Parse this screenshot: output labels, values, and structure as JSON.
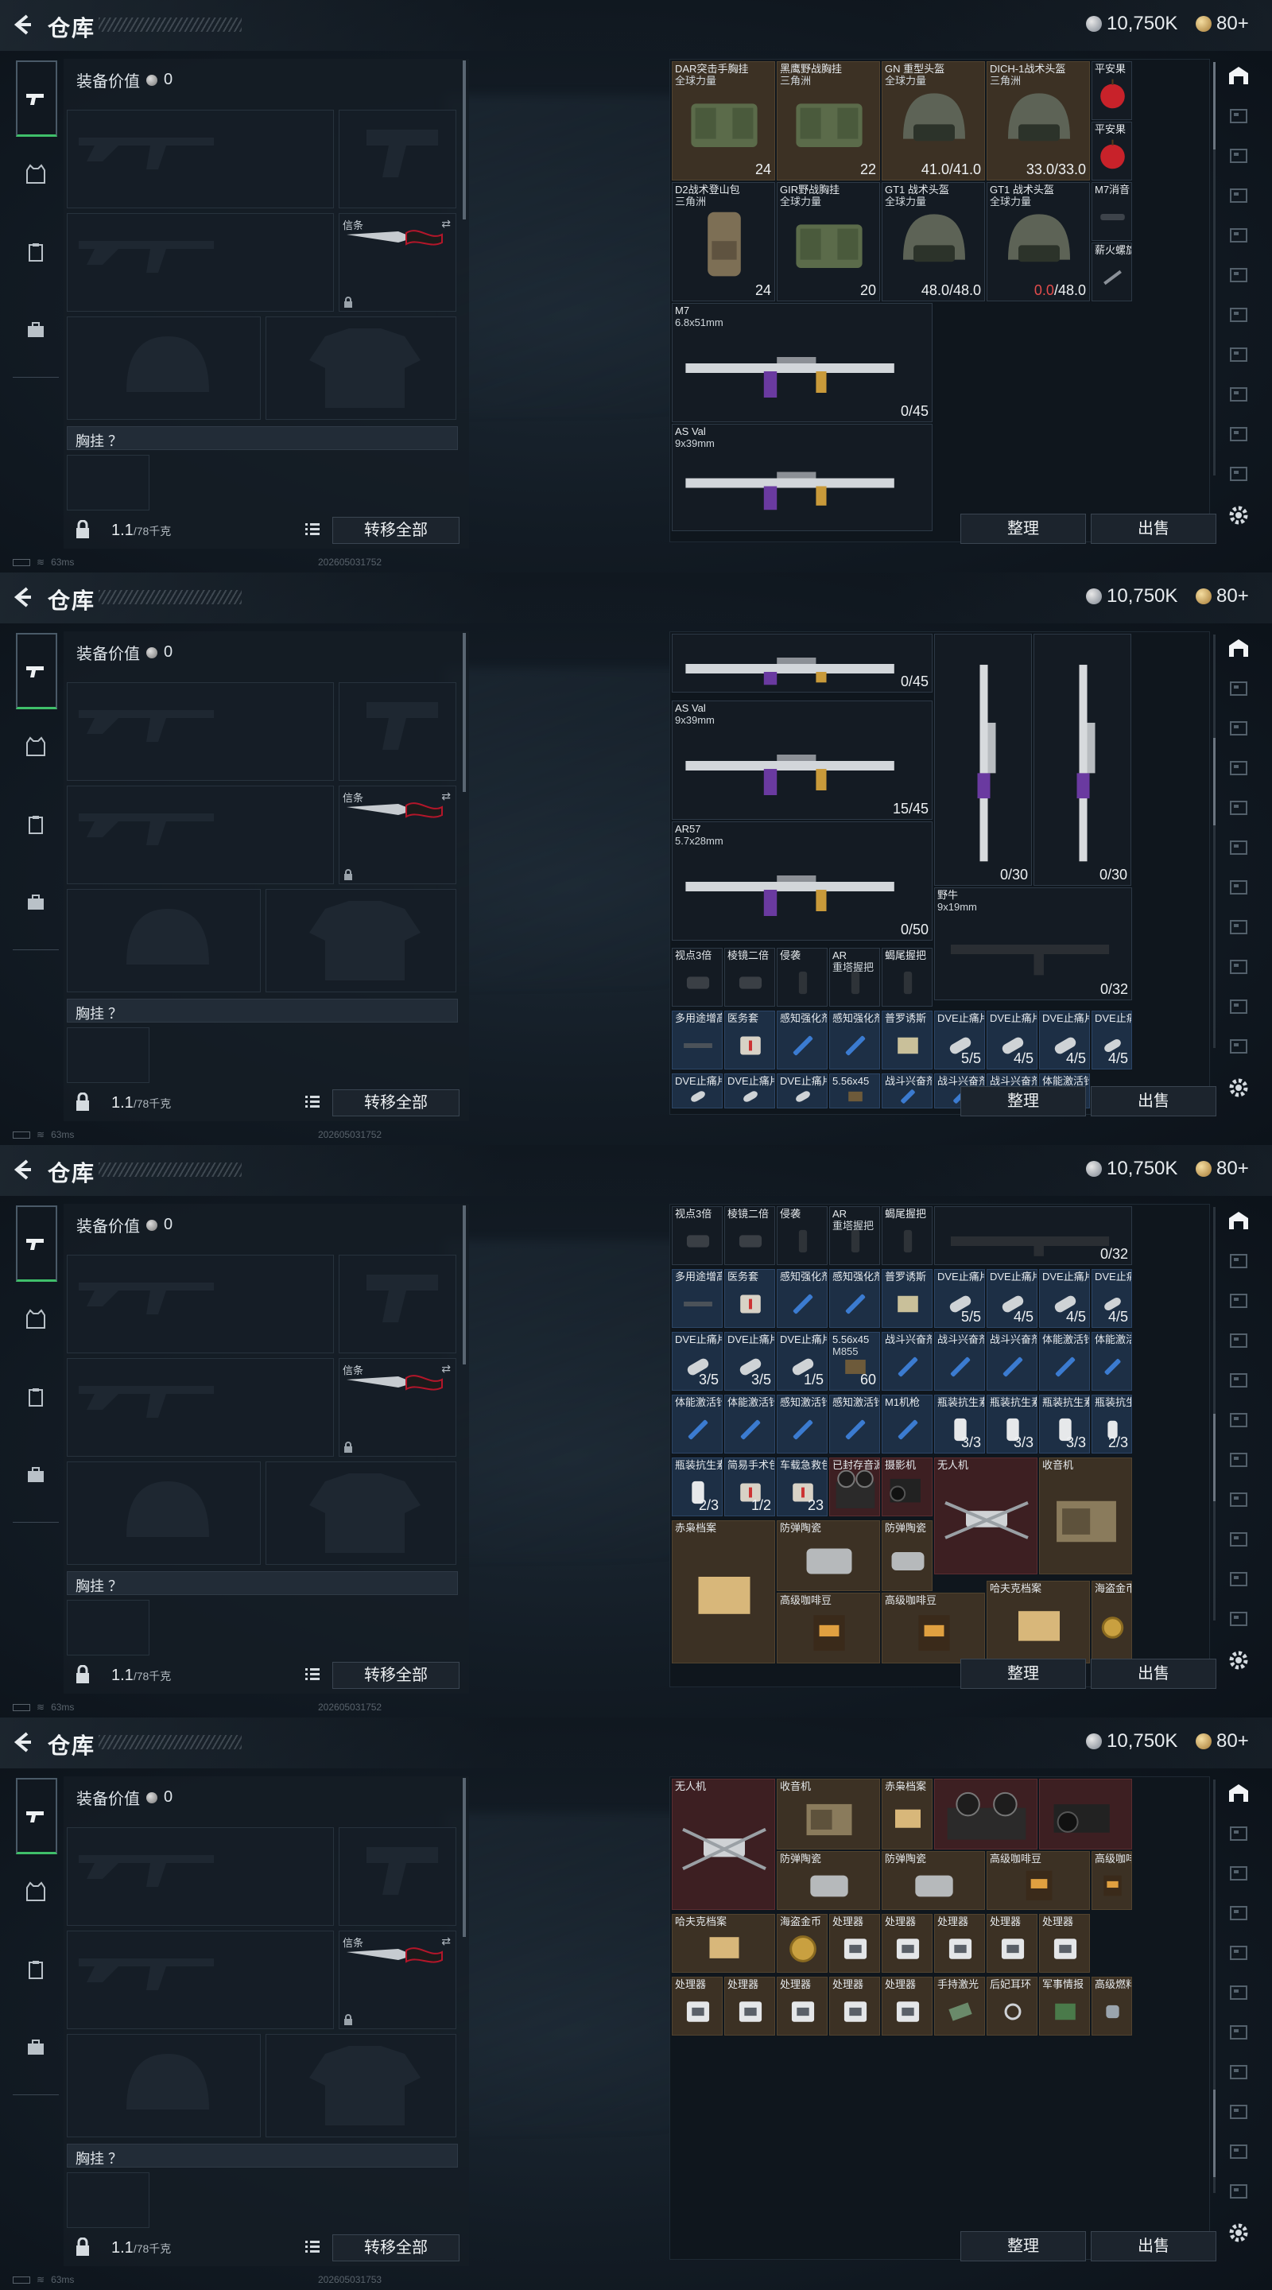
{
  "header": {
    "title": "仓库",
    "currency_coins": "10,750K",
    "currency_gold": "80+"
  },
  "loadout": {
    "equip_value_label": "装备价值",
    "equip_value": "0",
    "melee_label": "信条",
    "chest_label": "胸挂 ？",
    "weight_value": "1.1",
    "weight_cap": "/78千克",
    "transfer_all": "转移全部"
  },
  "status": {
    "latency": "63ms",
    "timestamps": [
      "202605031752",
      "202605031752",
      "202605031752",
      "202605031753"
    ]
  },
  "actions": {
    "sort": "整理",
    "sell": "出售"
  },
  "panels": [
    {
      "cells": [
        {
          "name": "DAR突击手胸挂",
          "sub": "全球力量",
          "qty": "24",
          "icon": "armor-icon",
          "color": "brown"
        },
        {
          "name": "黑鹰野战胸挂",
          "sub": "三角洲",
          "qty": "22",
          "icon": "armor-icon",
          "color": "brown"
        },
        {
          "name": "GN 重型头盔",
          "sub": "全球力量",
          "qty": "41.0/41.0",
          "icon": "helmet-icon",
          "color": "brown"
        },
        {
          "name": "DICH-1战术头盔",
          "sub": "三角洲",
          "qty": "33.0/33.0",
          "icon": "helmet-icon",
          "color": "brown"
        },
        {
          "name": "平安果",
          "sub": "",
          "qty": "",
          "icon": "apple-icon",
          "color": "dark"
        },
        {
          "name": "平安果",
          "sub": "",
          "qty": "",
          "icon": "apple-icon",
          "color": "dark"
        },
        {
          "name": "D2战术登山包",
          "sub": "三角洲",
          "qty": "24",
          "icon": "backpack-icon",
          "color": "dark"
        },
        {
          "name": "GIR野战胸挂",
          "sub": "全球力量",
          "qty": "20",
          "icon": "armor-icon",
          "color": "dark"
        },
        {
          "name": "GT1 战术头盔",
          "sub": "全球力量",
          "qty": "48.0/48.0",
          "icon": "helmet-icon",
          "color": "dark"
        },
        {
          "name": "GT1 战术头盔",
          "sub": "全球力量",
          "qty_red": "0.0",
          "qty": "/48.0",
          "icon": "helmet-icon",
          "color": "dark"
        },
        {
          "name": "M7消音",
          "sub": "",
          "qty": "",
          "icon": "suppressor-icon",
          "color": "dark"
        },
        {
          "name": "薪火螺旋",
          "sub": "",
          "qty": "",
          "icon": "attachment-icon",
          "color": "dark"
        },
        {
          "name": "M7",
          "sub": "6.8x51mm",
          "qty": "0/45",
          "icon": "rifle-icon",
          "color": "dark"
        },
        {
          "name": "M7",
          "sub": "6.8x51mm",
          "qty": "",
          "icon": "rifle-icon",
          "color": "dark"
        },
        {
          "name": "M7",
          "sub": "6.8x51mm",
          "qty": "",
          "icon": "rifle-icon",
          "color": "dark"
        },
        {
          "name": "AS Val",
          "sub": "9x39mm",
          "qty": "",
          "icon": "rifle-icon",
          "color": "dark"
        }
      ]
    },
    {
      "cells": [
        {
          "name": "",
          "sub": "",
          "qty": "0/45",
          "icon": "rifle-icon",
          "color": "dark"
        },
        {
          "name": "AS Val",
          "sub": "9x39mm",
          "qty": "15/45",
          "icon": "rifle-icon",
          "color": "dark"
        },
        {
          "name": "",
          "sub": "",
          "qty": "0/30",
          "icon": "rifle-icon",
          "color": "dark"
        },
        {
          "name": "",
          "sub": "",
          "qty": "0/30",
          "icon": "rifle-icon",
          "color": "dark"
        },
        {
          "name": "AR57",
          "sub": "5.7x28mm",
          "qty": "0/50",
          "icon": "rifle-icon",
          "color": "dark"
        },
        {
          "name": "野牛",
          "sub": "9x19mm",
          "qty": "0/32",
          "icon": "smg-icon",
          "color": "dark"
        },
        {
          "name": "视点3倍",
          "sub": "",
          "qty": "",
          "icon": "scope-icon",
          "color": "dark"
        },
        {
          "name": "棱镜二倍",
          "sub": "",
          "qty": "",
          "icon": "scope-icon",
          "color": "dark"
        },
        {
          "name": "侵袭",
          "sub": "",
          "qty": "",
          "icon": "grip-icon",
          "color": "dark"
        },
        {
          "name": "AR",
          "sub": "重塔握把",
          "qty": "",
          "icon": "grip-icon",
          "color": "dark"
        },
        {
          "name": "蝎尾握把",
          "sub": "",
          "qty": "",
          "icon": "grip-icon",
          "color": "dark"
        },
        {
          "name": "多用途增高",
          "sub": "",
          "qty": "",
          "icon": "rail-icon",
          "color": "blue"
        },
        {
          "name": "医务套",
          "sub": "",
          "qty": "",
          "icon": "medkit-icon",
          "color": "blue"
        },
        {
          "name": "感知强化剂",
          "sub": "",
          "qty": "",
          "icon": "syringe-icon",
          "color": "blue"
        },
        {
          "name": "感知强化剂",
          "sub": "",
          "qty": "",
          "icon": "syringe-icon",
          "color": "blue"
        },
        {
          "name": "普罗诱斯",
          "sub": "",
          "qty": "",
          "icon": "bandage-icon",
          "color": "blue"
        },
        {
          "name": "DVE止痛片",
          "sub": "",
          "qty": "5/5",
          "icon": "pill-icon",
          "color": "blue"
        },
        {
          "name": "DVE止痛片",
          "sub": "",
          "qty": "4/5",
          "icon": "pill-icon",
          "color": "blue"
        },
        {
          "name": "DVE止痛片",
          "sub": "",
          "qty": "4/5",
          "icon": "pill-icon",
          "color": "blue"
        },
        {
          "name": "DVE止痛片",
          "sub": "",
          "qty": "4/5",
          "icon": "pill-icon",
          "color": "blue"
        },
        {
          "name": "DVE止痛片",
          "sub": "",
          "qty": "",
          "icon": "pill-icon",
          "color": "blue"
        },
        {
          "name": "DVE止痛片",
          "sub": "",
          "qty": "",
          "icon": "pill-icon",
          "color": "blue"
        },
        {
          "name": "DVE止痛片",
          "sub": "",
          "qty": "",
          "icon": "pill-icon",
          "color": "blue"
        },
        {
          "name": "5.56x45",
          "sub": "",
          "qty": "",
          "icon": "ammo-icon",
          "color": "blue"
        },
        {
          "name": "战斗兴奋剂",
          "sub": "",
          "qty": "",
          "icon": "syringe-icon",
          "color": "blue"
        },
        {
          "name": "战斗兴奋剂",
          "sub": "",
          "qty": "",
          "icon": "syringe-icon",
          "color": "blue"
        },
        {
          "name": "战斗兴奋剂",
          "sub": "",
          "qty": "",
          "icon": "syringe-icon",
          "color": "blue"
        },
        {
          "name": "体能激活针",
          "sub": "",
          "qty": "",
          "icon": "syringe-icon",
          "color": "blue"
        }
      ]
    },
    {
      "cells": [
        {
          "name": "视点3倍",
          "sub": "",
          "qty": "",
          "icon": "scope-icon",
          "color": "dark"
        },
        {
          "name": "棱镜二倍",
          "sub": "",
          "qty": "",
          "icon": "scope-icon",
          "color": "dark"
        },
        {
          "name": "侵袭",
          "sub": "",
          "qty": "",
          "icon": "grip-icon",
          "color": "dark"
        },
        {
          "name": "AR",
          "sub": "重塔握把",
          "qty": "",
          "icon": "grip-icon",
          "color": "dark"
        },
        {
          "name": "蝎尾握把",
          "sub": "",
          "qty": "",
          "icon": "grip-icon",
          "color": "dark"
        },
        {
          "name": "",
          "sub": "",
          "qty": "0/32",
          "icon": "smg-icon",
          "color": "dark"
        },
        {
          "name": "多用途增高",
          "sub": "",
          "qty": "",
          "icon": "rail-icon",
          "color": "blue"
        },
        {
          "name": "医务套",
          "sub": "",
          "qty": "",
          "icon": "medkit-icon",
          "color": "blue"
        },
        {
          "name": "感知强化剂",
          "sub": "",
          "qty": "",
          "icon": "syringe-icon",
          "color": "blue"
        },
        {
          "name": "感知强化剂",
          "sub": "",
          "qty": "",
          "icon": "syringe-icon",
          "color": "blue"
        },
        {
          "name": "普罗诱斯",
          "sub": "",
          "qty": "",
          "icon": "bandage-icon",
          "color": "blue"
        },
        {
          "name": "DVE止痛片",
          "sub": "",
          "qty": "5/5",
          "icon": "pill-icon",
          "color": "blue"
        },
        {
          "name": "DVE止痛片",
          "sub": "",
          "qty": "4/5",
          "icon": "pill-icon",
          "color": "blue"
        },
        {
          "name": "DVE止痛片",
          "sub": "",
          "qty": "4/5",
          "icon": "pill-icon",
          "color": "blue"
        },
        {
          "name": "DVE止痛片",
          "sub": "",
          "qty": "4/5",
          "icon": "pill-icon",
          "color": "blue"
        },
        {
          "name": "DVE止痛片",
          "sub": "",
          "qty": "3/5",
          "icon": "pill-icon",
          "color": "blue"
        },
        {
          "name": "DVE止痛片",
          "sub": "",
          "qty": "3/5",
          "icon": "pill-icon",
          "color": "blue"
        },
        {
          "name": "DVE止痛片",
          "sub": "",
          "qty": "1/5",
          "icon": "pill-icon",
          "color": "blue"
        },
        {
          "name": "5.56x45",
          "sub": "M855",
          "qty": "60",
          "icon": "ammo-icon",
          "color": "blue"
        },
        {
          "name": "战斗兴奋剂",
          "sub": "",
          "qty": "",
          "icon": "syringe-icon",
          "color": "blue"
        },
        {
          "name": "战斗兴奋剂",
          "sub": "",
          "qty": "",
          "icon": "syringe-icon",
          "color": "blue"
        },
        {
          "name": "战斗兴奋剂",
          "sub": "",
          "qty": "",
          "icon": "syringe-icon",
          "color": "blue"
        },
        {
          "name": "体能激活针",
          "sub": "",
          "qty": "",
          "icon": "syringe-icon",
          "color": "blue"
        },
        {
          "name": "体能激活针",
          "sub": "",
          "qty": "",
          "icon": "syringe-icon",
          "color": "blue"
        },
        {
          "name": "体能激活针",
          "sub": "",
          "qty": "",
          "icon": "syringe-icon",
          "color": "blue"
        },
        {
          "name": "体能激活针",
          "sub": "",
          "qty": "",
          "icon": "syringe-icon",
          "color": "blue"
        },
        {
          "name": "感知激活针",
          "sub": "",
          "qty": "",
          "icon": "syringe-icon",
          "color": "blue"
        },
        {
          "name": "感知激活针",
          "sub": "",
          "qty": "",
          "icon": "syringe-icon",
          "color": "blue"
        },
        {
          "name": "M1机枪",
          "sub": "",
          "qty": "",
          "icon": "syringe-icon",
          "color": "blue"
        },
        {
          "name": "瓶装抗生素",
          "sub": "",
          "qty": "3/3",
          "icon": "bottle-icon",
          "color": "blue"
        },
        {
          "name": "瓶装抗生素",
          "sub": "",
          "qty": "3/3",
          "icon": "bottle-icon",
          "color": "blue"
        },
        {
          "name": "瓶装抗生素",
          "sub": "",
          "qty": "3/3",
          "icon": "bottle-icon",
          "color": "blue"
        },
        {
          "name": "瓶装抗生素",
          "sub": "",
          "qty": "2/3",
          "icon": "bottle-icon",
          "color": "blue"
        },
        {
          "name": "瓶装抗生素",
          "sub": "",
          "qty": "2/3",
          "icon": "bottle-icon",
          "color": "blue"
        },
        {
          "name": "简易手术包",
          "sub": "",
          "qty": "1/2",
          "icon": "medkit-icon",
          "color": "blue"
        },
        {
          "name": "车载急救包",
          "sub": "",
          "qty": "23",
          "icon": "medkit-icon",
          "color": "blue"
        },
        {
          "name": "已封存音源",
          "sub": "",
          "qty": "",
          "icon": "reel-recorder-icon",
          "color": "red"
        },
        {
          "name": "摄影机",
          "sub": "",
          "qty": "",
          "icon": "camera-icon",
          "color": "red"
        },
        {
          "name": "无人机",
          "sub": "",
          "qty": "",
          "icon": "drone-icon",
          "color": "red"
        },
        {
          "name": "收音机",
          "sub": "",
          "qty": "",
          "icon": "radio-icon",
          "color": "brown"
        },
        {
          "name": "赤枭档案",
          "sub": "",
          "qty": "",
          "icon": "document-icon",
          "color": "brown"
        },
        {
          "name": "防弹陶瓷",
          "sub": "",
          "qty": "",
          "icon": "plate-icon",
          "color": "brown"
        },
        {
          "name": "防弹陶瓷",
          "sub": "",
          "qty": "",
          "icon": "plate-icon",
          "color": "brown"
        },
        {
          "name": "高级咖啡豆",
          "sub": "",
          "qty": "",
          "icon": "coffee-icon",
          "color": "brown"
        },
        {
          "name": "高级咖啡豆",
          "sub": "",
          "qty": "",
          "icon": "coffee-icon",
          "color": "brown"
        },
        {
          "name": "哈夫克档案",
          "sub": "",
          "qty": "",
          "icon": "document-icon",
          "color": "brown"
        },
        {
          "name": "海盗金币",
          "sub": "",
          "qty": "",
          "icon": "coin-icon",
          "color": "brown"
        },
        {
          "name": "处理器",
          "sub": "",
          "qty": "",
          "icon": "processor-icon",
          "color": "brown"
        },
        {
          "name": "处理器",
          "sub": "",
          "qty": "",
          "icon": "processor-icon",
          "color": "brown"
        }
      ]
    },
    {
      "cells": [
        {
          "name": "无人机",
          "sub": "",
          "qty": "",
          "icon": "drone-icon",
          "color": "red"
        },
        {
          "name": "收音机",
          "sub": "",
          "qty": "",
          "icon": "radio-icon",
          "color": "brown"
        },
        {
          "name": "赤枭档案",
          "sub": "",
          "qty": "",
          "icon": "document-icon",
          "color": "brown"
        },
        {
          "name": "",
          "sub": "",
          "qty": "",
          "icon": "reel-recorder-icon",
          "color": "red"
        },
        {
          "name": "",
          "sub": "",
          "qty": "",
          "icon": "camera-icon",
          "color": "red"
        },
        {
          "name": "防弹陶瓷",
          "sub": "",
          "qty": "",
          "icon": "plate-icon",
          "color": "brown"
        },
        {
          "name": "防弹陶瓷",
          "sub": "",
          "qty": "",
          "icon": "plate-icon",
          "color": "brown"
        },
        {
          "name": "高级咖啡豆",
          "sub": "",
          "qty": "",
          "icon": "coffee-icon",
          "color": "brown"
        },
        {
          "name": "高级咖啡豆",
          "sub": "",
          "qty": "",
          "icon": "coffee-icon",
          "color": "brown"
        },
        {
          "name": "哈夫克档案",
          "sub": "",
          "qty": "",
          "icon": "document-icon",
          "color": "brown"
        },
        {
          "name": "海盗金币",
          "sub": "",
          "qty": "",
          "icon": "coin-icon",
          "color": "brown"
        },
        {
          "name": "处理器",
          "sub": "",
          "qty": "",
          "icon": "processor-icon",
          "color": "brown"
        },
        {
          "name": "处理器",
          "sub": "",
          "qty": "",
          "icon": "processor-icon",
          "color": "brown"
        },
        {
          "name": "处理器",
          "sub": "",
          "qty": "",
          "icon": "processor-icon",
          "color": "brown"
        },
        {
          "name": "处理器",
          "sub": "",
          "qty": "",
          "icon": "processor-icon",
          "color": "brown"
        },
        {
          "name": "处理器",
          "sub": "",
          "qty": "",
          "icon": "processor-icon",
          "color": "brown"
        },
        {
          "name": "处理器",
          "sub": "",
          "qty": "",
          "icon": "processor-icon",
          "color": "brown"
        },
        {
          "name": "处理器",
          "sub": "",
          "qty": "",
          "icon": "processor-icon",
          "color": "brown"
        },
        {
          "name": "处理器",
          "sub": "",
          "qty": "",
          "icon": "processor-icon",
          "color": "brown"
        },
        {
          "name": "处理器",
          "sub": "",
          "qty": "",
          "icon": "processor-icon",
          "color": "brown"
        },
        {
          "name": "处理器",
          "sub": "",
          "qty": "",
          "icon": "processor-icon",
          "color": "brown"
        },
        {
          "name": "手持激光",
          "sub": "",
          "qty": "",
          "icon": "laser-icon",
          "color": "brown"
        },
        {
          "name": "后妃耳环",
          "sub": "",
          "qty": "",
          "icon": "earring-icon",
          "color": "brown"
        },
        {
          "name": "军事情报",
          "sub": "",
          "qty": "",
          "icon": "chip-icon",
          "color": "brown"
        },
        {
          "name": "高级燃料",
          "sub": "",
          "qty": "",
          "icon": "fuel-icon",
          "color": "brown"
        }
      ]
    }
  ]
}
